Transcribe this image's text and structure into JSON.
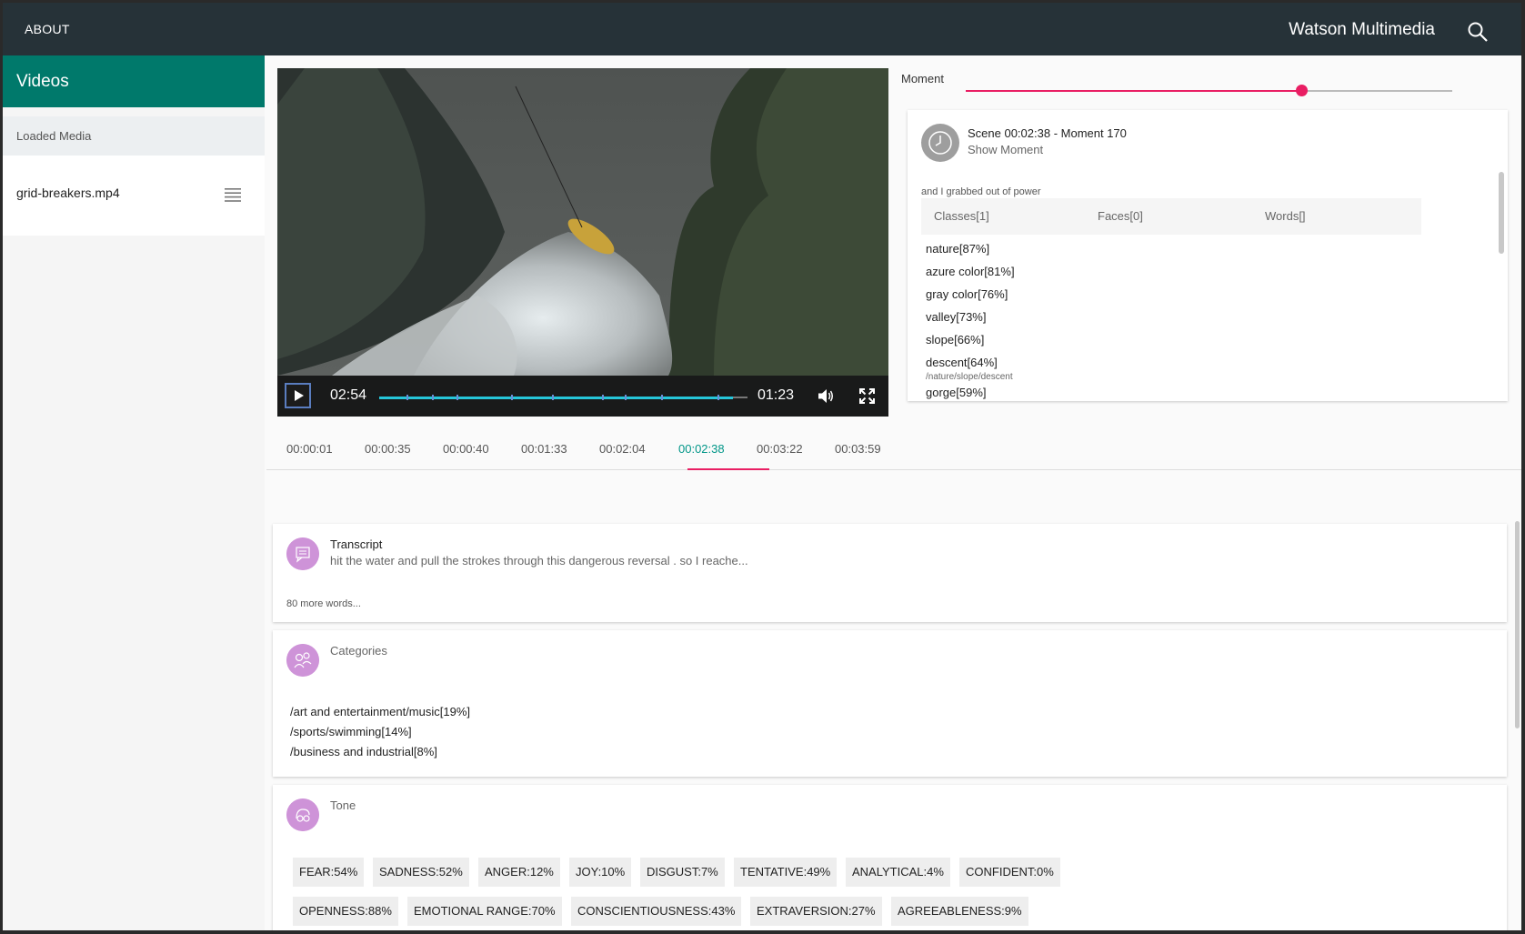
{
  "topbar": {
    "about": "ABOUT",
    "title": "Watson Multimedia"
  },
  "sidebar": {
    "header": "Videos",
    "section": "Loaded Media",
    "file": "grid-breakers.mp4"
  },
  "player": {
    "current_time": "02:54",
    "duration": "01:23",
    "progress_fraction": 0.96
  },
  "moment": {
    "label": "Moment",
    "slider_fraction": 0.69
  },
  "scene": {
    "title": "Scene 00:02:38 - Moment 170",
    "show": "Show Moment",
    "quote": "and I grabbed out of power",
    "tabs": [
      "Classes[1]",
      "Faces[0]",
      "Words[]"
    ],
    "classes": [
      {
        "label": "nature[87%]"
      },
      {
        "label": "azure color[81%]"
      },
      {
        "label": "gray color[76%]"
      },
      {
        "label": "valley[73%]"
      },
      {
        "label": "slope[66%]"
      },
      {
        "label": "descent[64%]",
        "sub": "/nature/slope/descent"
      },
      {
        "label": "gorge[59%]"
      }
    ]
  },
  "timestamps": {
    "items": [
      "00:00:01",
      "00:00:35",
      "00:00:40",
      "00:01:33",
      "00:02:04",
      "00:02:38",
      "00:03:22",
      "00:03:59"
    ],
    "active_index": 5
  },
  "transcript": {
    "title": "Transcript",
    "snippet": "hit the water and pull the strokes through this dangerous reversal . so I reache...",
    "more": "80 more words..."
  },
  "categories": {
    "title": "Categories",
    "items": [
      "/art and entertainment/music[19%]",
      "/sports/swimming[14%]",
      "/business and industrial[8%]"
    ]
  },
  "tone": {
    "title": "Tone",
    "row1": [
      "FEAR:54%",
      "SADNESS:52%",
      "ANGER:12%",
      "JOY:10%",
      "DISGUST:7%",
      "TENTATIVE:49%",
      "ANALYTICAL:4%",
      "CONFIDENT:0%"
    ],
    "row2": [
      "OPENNESS:88%",
      "EMOTIONAL RANGE:70%",
      "CONSCIENTIOUSNESS:43%",
      "EXTRAVERSION:27%",
      "AGREEABLENESS:9%"
    ]
  },
  "colors": {
    "topbar": "#263238",
    "sidebar_header": "#00796b",
    "accent_pink": "#e91e63",
    "active_teal": "#009688",
    "icon_purple": "#ce93d8"
  }
}
